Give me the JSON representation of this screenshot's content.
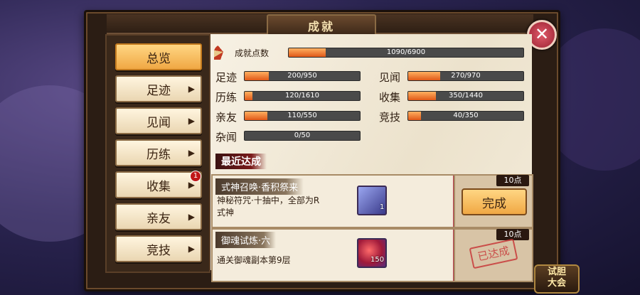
{
  "title": "成就",
  "close_symbol": "✕",
  "sidebar": {
    "items": [
      {
        "label": "总览",
        "active": true
      },
      {
        "label": "足迹"
      },
      {
        "label": "见闻"
      },
      {
        "label": "历练"
      },
      {
        "label": "收集",
        "badge": "1"
      },
      {
        "label": "亲友"
      },
      {
        "label": "竞技"
      }
    ],
    "arrow": "▶"
  },
  "achievement_points": {
    "label": "成就点数",
    "value": "1090/6900",
    "progress": 0.158
  },
  "stats": [
    {
      "label": "足迹",
      "value": "200/950",
      "progress": 0.21
    },
    {
      "label": "见闻",
      "value": "270/970",
      "progress": 0.28
    },
    {
      "label": "历练",
      "value": "120/1610",
      "progress": 0.07
    },
    {
      "label": "收集",
      "value": "350/1440",
      "progress": 0.24
    },
    {
      "label": "亲友",
      "value": "110/550",
      "progress": 0.2
    },
    {
      "label": "竞技",
      "value": "40/350",
      "progress": 0.11
    },
    {
      "label": "杂闻",
      "value": "0/50",
      "progress": 0.0
    }
  ],
  "recent_section": "最近达成",
  "achievements": [
    {
      "title": "式神召唤·香积祭来",
      "desc_line1": "神秘符咒·十抽中，全部为R",
      "desc_line2": "式神",
      "item_count": "1",
      "points": "10点",
      "action": "完成",
      "item_color": "#5a64c8"
    },
    {
      "title": "御魂试炼·六",
      "desc_line1": "通关御魂副本第9层",
      "item_count": "150",
      "points": "10点",
      "status": "已达成",
      "item_color": "#8a3aa6"
    }
  ],
  "event_badge": {
    "line1": "试胆",
    "line2": "大会"
  }
}
